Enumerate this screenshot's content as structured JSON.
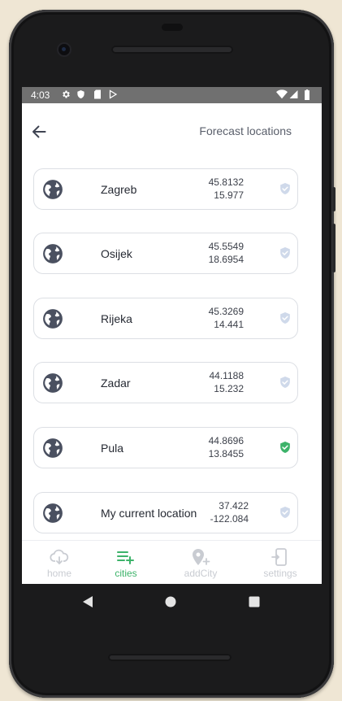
{
  "status_bar": {
    "time": "4:03"
  },
  "app_bar": {
    "title": "Forecast locations"
  },
  "locations": [
    {
      "name": "Zagreb",
      "lat": "45.8132",
      "lon": "15.977",
      "selected": false
    },
    {
      "name": "Osijek",
      "lat": "45.5549",
      "lon": "18.6954",
      "selected": false
    },
    {
      "name": "Rijeka",
      "lat": "45.3269",
      "lon": "14.441",
      "selected": false
    },
    {
      "name": "Zadar",
      "lat": "44.1188",
      "lon": "15.232",
      "selected": false
    },
    {
      "name": "Pula",
      "lat": "44.8696",
      "lon": "13.8455",
      "selected": true
    },
    {
      "name": "My current location",
      "lat": "37.422",
      "lon": "-122.084",
      "selected": false
    }
  ],
  "bottom_nav": [
    {
      "label": "home",
      "icon": "cloud-icon",
      "active": false
    },
    {
      "label": "cities",
      "icon": "playlist-add-icon",
      "active": true
    },
    {
      "label": "addCity",
      "icon": "add-location-icon",
      "active": false
    },
    {
      "label": "settings",
      "icon": "phone-settings-icon",
      "active": false
    }
  ],
  "colors": {
    "accent": "#3db36a",
    "inactive_nav": "#c9ccd2",
    "icon_dark": "#4a5060",
    "status_bar_bg": "#707070"
  }
}
